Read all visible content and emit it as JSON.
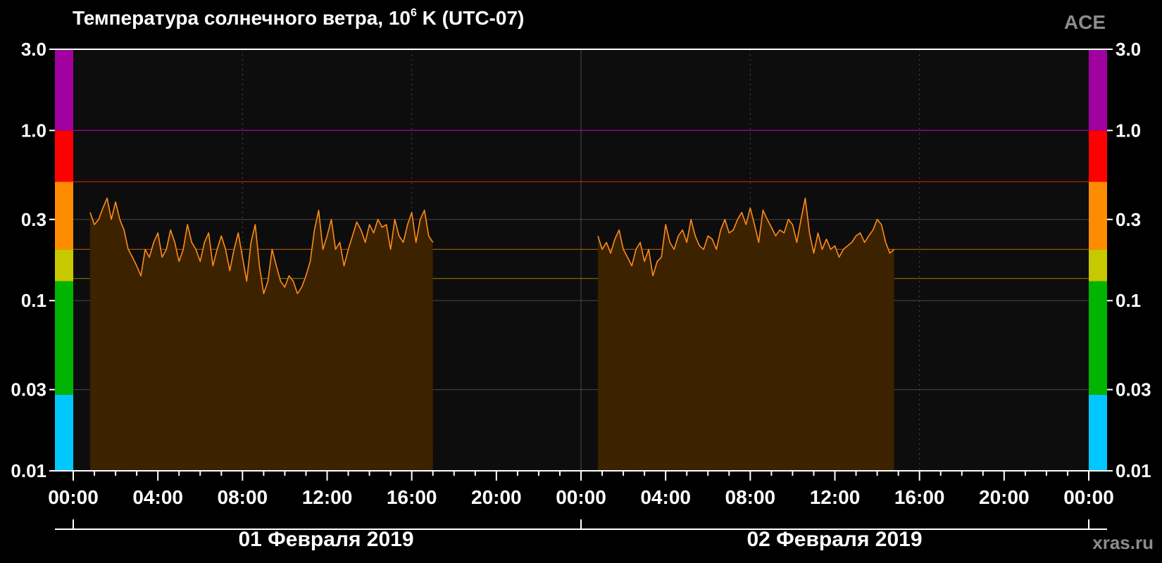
{
  "header": {
    "title_prefix": "Температура солнечного ветра, 10",
    "title_exp": "6",
    "title_suffix": " K (UTC-07)",
    "source": "ACE",
    "site": "xras.ru"
  },
  "dates": [
    "01 Февраля 2019",
    "02 Февраля 2019"
  ],
  "colors": {
    "line": "#ff8c1a",
    "fill": "#3d2200",
    "plot_bg": "#0d0d0d",
    "grid": "#4a4a4a",
    "scale_bands": [
      "#00c8ff",
      "#00b400",
      "#c8c800",
      "#ff8c00",
      "#ff0000",
      "#a000a0"
    ]
  },
  "chart_data": {
    "type": "area",
    "title": "Температура солнечного ветра, 10^6 K (UTC-07)",
    "y_scale": "log",
    "ylim": [
      0.01,
      3.0
    ],
    "y_ticks": [
      3.0,
      1.0,
      0.3,
      0.1,
      0.03,
      0.01
    ],
    "y_tick_labels": [
      "3.0",
      "1.0",
      "0.3",
      "0.1",
      "0.03",
      "0.01"
    ],
    "x_range_hours": [
      0,
      48
    ],
    "x_ticks": [
      "00:00",
      "04:00",
      "08:00",
      "12:00",
      "16:00",
      "20:00",
      "00:00",
      "04:00",
      "08:00",
      "12:00",
      "16:00",
      "20:00",
      "00:00"
    ],
    "threshold_lines": [
      {
        "value": 1.0,
        "color": "#a000a0"
      },
      {
        "value": 0.5,
        "color": "#c82800"
      },
      {
        "value": 0.2,
        "color": "#a05000"
      },
      {
        "value": 0.135,
        "color": "#8a7000"
      }
    ],
    "scale_band_bounds": [
      0.01,
      0.028,
      0.13,
      0.2,
      0.5,
      1.0,
      3.0
    ],
    "series": [
      {
        "x": [
          0.8,
          1.0,
          1.2,
          1.4,
          1.6,
          1.8,
          2.0,
          2.2,
          2.4,
          2.6,
          2.8,
          3.0,
          3.2,
          3.4,
          3.6,
          3.8,
          4.0,
          4.2,
          4.4,
          4.6,
          4.8,
          5.0,
          5.2,
          5.4,
          5.6,
          5.8,
          6.0,
          6.2,
          6.4,
          6.6,
          6.8,
          7.0,
          7.2,
          7.4,
          7.6,
          7.8,
          8.0,
          8.2,
          8.4,
          8.6,
          8.8,
          9.0,
          9.2,
          9.4,
          9.6,
          9.8,
          10.0,
          10.2,
          10.4,
          10.6,
          10.8,
          11.0,
          11.2,
          11.4,
          11.6,
          11.8,
          12.0,
          12.2,
          12.4,
          12.6,
          12.8,
          13.0,
          13.2,
          13.4,
          13.6,
          13.8,
          14.0,
          14.2,
          14.4,
          14.6,
          14.8,
          15.0,
          15.2,
          15.4,
          15.6,
          15.8,
          16.0,
          16.2,
          16.4,
          16.6,
          16.8,
          17.0
        ],
        "y": [
          0.33,
          0.28,
          0.3,
          0.35,
          0.4,
          0.3,
          0.38,
          0.3,
          0.26,
          0.2,
          0.18,
          0.16,
          0.14,
          0.2,
          0.18,
          0.22,
          0.25,
          0.18,
          0.2,
          0.26,
          0.22,
          0.17,
          0.2,
          0.28,
          0.22,
          0.2,
          0.17,
          0.22,
          0.25,
          0.16,
          0.2,
          0.24,
          0.2,
          0.15,
          0.2,
          0.25,
          0.18,
          0.13,
          0.22,
          0.28,
          0.16,
          0.11,
          0.13,
          0.2,
          0.16,
          0.13,
          0.12,
          0.14,
          0.13,
          0.11,
          0.12,
          0.14,
          0.17,
          0.26,
          0.34,
          0.2,
          0.24,
          0.3,
          0.2,
          0.22,
          0.16,
          0.2,
          0.24,
          0.29,
          0.26,
          0.22,
          0.28,
          0.25,
          0.3,
          0.27,
          0.28,
          0.2,
          0.3,
          0.24,
          0.22,
          0.28,
          0.33,
          0.22,
          0.3,
          0.34,
          0.24,
          0.22
        ]
      },
      {
        "x": [
          24.8,
          25.0,
          25.2,
          25.4,
          25.6,
          25.8,
          26.0,
          26.2,
          26.4,
          26.6,
          26.8,
          27.0,
          27.2,
          27.4,
          27.6,
          27.8,
          28.0,
          28.2,
          28.4,
          28.6,
          28.8,
          29.0,
          29.2,
          29.4,
          29.6,
          29.8,
          30.0,
          30.2,
          30.4,
          30.6,
          30.8,
          31.0,
          31.2,
          31.4,
          31.6,
          31.8,
          32.0,
          32.2,
          32.4,
          32.6,
          32.8,
          33.0,
          33.2,
          33.4,
          33.6,
          33.8,
          34.0,
          34.2,
          34.4,
          34.6,
          34.8,
          35.0,
          35.2,
          35.4,
          35.6,
          35.8,
          36.0,
          36.2,
          36.4,
          36.6,
          36.8,
          37.0,
          37.2,
          37.4,
          37.6,
          37.8,
          38.0,
          38.2,
          38.4,
          38.6,
          38.8
        ],
        "y": [
          0.24,
          0.2,
          0.22,
          0.19,
          0.23,
          0.26,
          0.2,
          0.18,
          0.16,
          0.2,
          0.22,
          0.17,
          0.2,
          0.14,
          0.17,
          0.18,
          0.28,
          0.22,
          0.2,
          0.24,
          0.26,
          0.22,
          0.3,
          0.24,
          0.21,
          0.2,
          0.24,
          0.23,
          0.2,
          0.26,
          0.3,
          0.25,
          0.26,
          0.3,
          0.33,
          0.28,
          0.35,
          0.28,
          0.22,
          0.34,
          0.3,
          0.27,
          0.24,
          0.26,
          0.25,
          0.3,
          0.28,
          0.22,
          0.3,
          0.4,
          0.25,
          0.19,
          0.25,
          0.2,
          0.23,
          0.2,
          0.21,
          0.18,
          0.2,
          0.21,
          0.22,
          0.24,
          0.25,
          0.22,
          0.24,
          0.26,
          0.3,
          0.28,
          0.22,
          0.19,
          0.2
        ]
      }
    ]
  }
}
